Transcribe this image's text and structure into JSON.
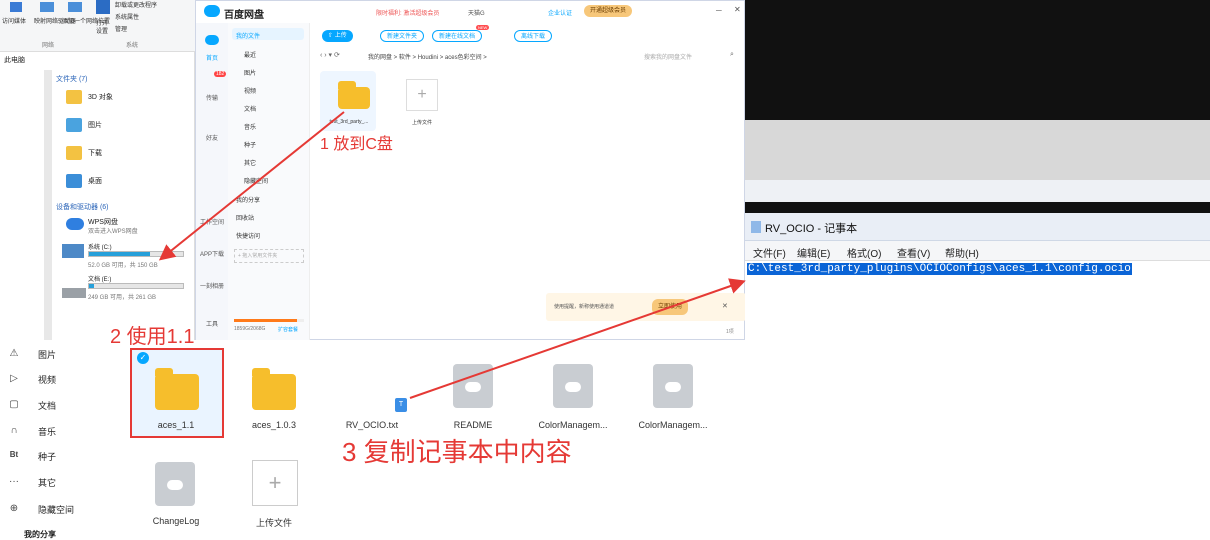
{
  "ribbon": {
    "items": [
      "访问媒体",
      "映射网络驱动器",
      "添加一个网络位置",
      "打开",
      "设置",
      "卸载或更改程序",
      "系统属性",
      "管理"
    ],
    "groups": [
      "网络",
      "系统"
    ]
  },
  "explorer": {
    "this_pc": "此电脑",
    "folders_header": "文件夹 (7)",
    "folders": [
      "3D 对象",
      "图片",
      "下载",
      "桌面"
    ],
    "devices_header": "设备和驱动器 (6)",
    "wps": {
      "name": "WPS网盘",
      "sub": "双击进入WPS网盘"
    },
    "drive_c": {
      "name": "系统 (C:)",
      "free": "52.0 GB 可用，共 150 GB",
      "used_fraction": 0.65
    },
    "drive_e": {
      "name": "文档 (E:)",
      "free": "249 GB 可用，共 261 GB",
      "used_fraction": 0.05
    }
  },
  "baidu": {
    "title": "百度网盘",
    "promo": "限时福利: 激活超级会员",
    "vip_left": "天猫G",
    "enterprise": "企业认证",
    "open_vip": "开通超级会员",
    "left_tabs": [
      "首页",
      "传输",
      "好友",
      "工作空间",
      "APP下载",
      "一刻相册",
      "工具"
    ],
    "transfer_badge": "182",
    "nav": [
      "我的文件",
      "最近",
      "图片",
      "视频",
      "文档",
      "音乐",
      "种子",
      "其它",
      "隐藏空间",
      "我的分享",
      "回收站",
      "快捷访问"
    ],
    "quick_add": "+ 拖入常用文件夹",
    "storage_text": "1859G/2068G",
    "expand": "扩容套餐",
    "toolbar": {
      "upload": "上传",
      "new_folder": "新建文件夹",
      "new_online_doc": "新建在线文档",
      "offline": "离线下载",
      "new_badge": "NEW"
    },
    "breadcrumb": [
      "我的网盘",
      "软件",
      "Houdini",
      "aces色彩空间"
    ],
    "search_placeholder": "搜索我的网盘文件",
    "files": [
      {
        "name": "test_3rd_party_..."
      },
      {
        "name": "上传文件"
      }
    ],
    "tip": "使用提醒，新称使用通道道",
    "tip_btn": "立即使用",
    "item_count": "1项"
  },
  "lower": {
    "nav": [
      "图片",
      "视频",
      "文档",
      "音乐",
      "种子",
      "其它",
      "隐藏空间",
      "我的分享"
    ],
    "files": [
      {
        "name": "aces_1.1",
        "type": "folder"
      },
      {
        "name": "aces_1.0.3",
        "type": "folder"
      },
      {
        "name": "RV_OCIO.txt",
        "type": "txt"
      },
      {
        "name": "README",
        "type": "doc"
      },
      {
        "name": "ColorManagem...",
        "type": "doc"
      },
      {
        "name": "ColorManagem...",
        "type": "doc"
      },
      {
        "name": "ChangeLog",
        "type": "doc"
      },
      {
        "name": "上传文件",
        "type": "upload"
      }
    ]
  },
  "notepad": {
    "title": "RV_OCIO - 记事本",
    "menu": [
      "文件(F)",
      "编辑(E)",
      "格式(O)",
      "查看(V)",
      "帮助(H)"
    ],
    "content": "C:\\test_3rd_party_plugins\\OCIOConfigs\\aces_1.1\\config.ocio"
  },
  "annotations": {
    "step1": "1 放到C盘",
    "step2": "2 使用1.1",
    "step3": "3 复制记事本中内容",
    "color": "#e53935"
  }
}
